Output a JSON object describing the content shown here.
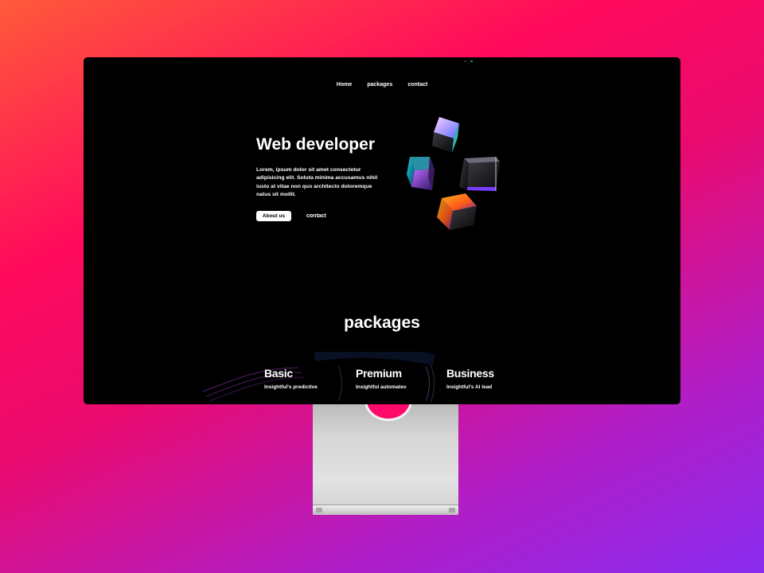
{
  "nav": {
    "items": [
      "Home",
      "packages",
      "contact"
    ]
  },
  "hero": {
    "title": "Web developer",
    "text": "Lorem, ipsum dolor sit amet consectetur adipisicing elit. Soluta minima accusamus nihil iusto at vitae non quo architecto doloremque natus sit mollit.",
    "primary_button": "About us",
    "secondary_link": "contact"
  },
  "packages": {
    "title": "packages",
    "cards": [
      {
        "name": "Basic",
        "desc": "Insightful's predictive"
      },
      {
        "name": "Premium",
        "desc": "Insightful automates"
      },
      {
        "name": "Business",
        "desc": "Insightful's AI lead"
      }
    ]
  },
  "colors": {
    "background_gradient": [
      "#ff5a3a",
      "#ff0a5c",
      "#b01ec8",
      "#8a2cf0"
    ],
    "screen": "#000000",
    "text": "#ffffff",
    "stand": "#d6d6d6"
  },
  "icons": [
    "camera-indicator",
    "3d-cubes-illustration"
  ]
}
